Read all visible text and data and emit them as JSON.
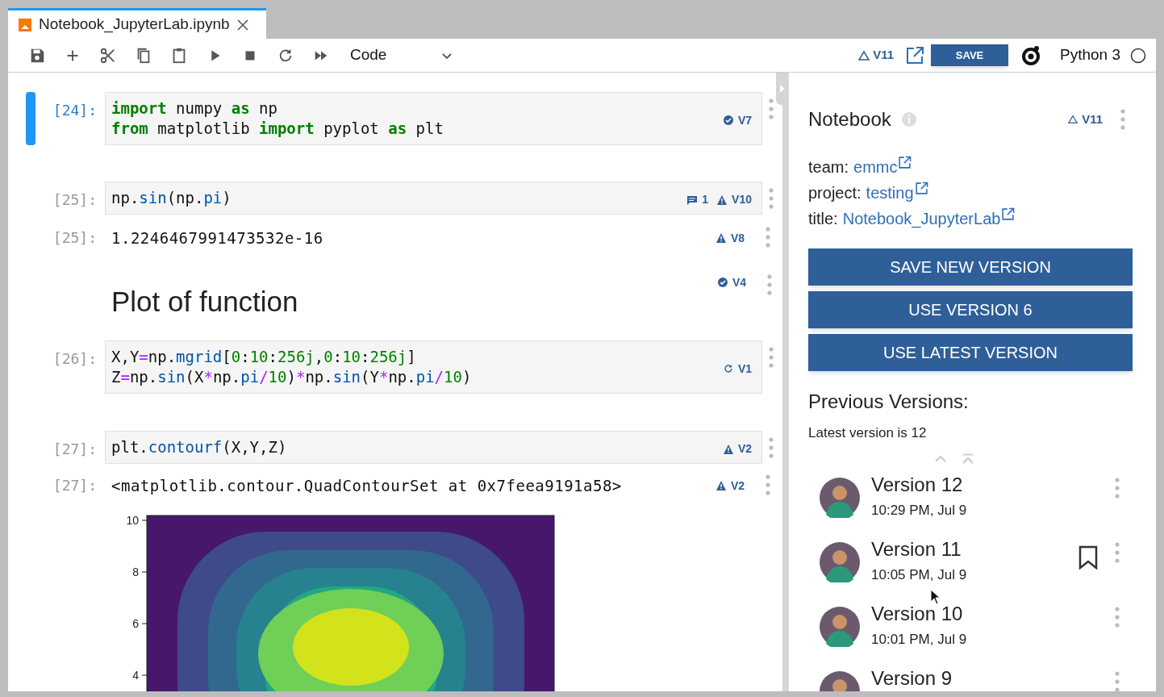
{
  "tab": {
    "title": "Notebook_JupyterLab.ipynb"
  },
  "toolbar": {
    "cell_type": "Code",
    "version": "V11",
    "save": "SAVE",
    "kernel": "Python 3"
  },
  "cells": [
    {
      "kind": "code",
      "prompt": "[24]:",
      "selected": true,
      "lines": [
        [
          {
            "kind": "keyword",
            "text": "import"
          },
          {
            "kind": "plain",
            "text": " numpy "
          },
          {
            "kind": "keyword",
            "text": "as"
          },
          {
            "kind": "plain",
            "text": " np"
          }
        ],
        [
          {
            "kind": "keyword",
            "text": "from"
          },
          {
            "kind": "plain",
            "text": " matplotlib "
          },
          {
            "kind": "keyword",
            "text": "import"
          },
          {
            "kind": "plain",
            "text": " pyplot "
          },
          {
            "kind": "keyword",
            "text": "as"
          },
          {
            "kind": "plain",
            "text": " plt"
          }
        ]
      ],
      "badges": [
        {
          "kind": "check",
          "text": "V7"
        }
      ]
    },
    {
      "kind": "code",
      "prompt": "[25]:",
      "selected": false,
      "lines": [
        [
          {
            "kind": "plain",
            "text": "np."
          },
          {
            "kind": "attr",
            "text": "sin"
          },
          {
            "kind": "plain",
            "text": "(np."
          },
          {
            "kind": "attr",
            "text": "pi"
          },
          {
            "kind": "plain",
            "text": ")"
          }
        ]
      ],
      "badges": [
        {
          "kind": "comment",
          "text": "1"
        },
        {
          "kind": "warn",
          "text": "V10"
        }
      ]
    },
    {
      "kind": "output",
      "prompt": "[25]:",
      "text": "1.2246467991473532e-16",
      "badges": [
        {
          "kind": "warn",
          "text": "V8"
        }
      ]
    },
    {
      "kind": "markdown",
      "text": "Plot of function",
      "badges": [
        {
          "kind": "check",
          "text": "V4"
        }
      ]
    },
    {
      "kind": "code",
      "prompt": "[26]:",
      "selected": false,
      "lines": [
        [
          {
            "kind": "plain",
            "text": "X,Y"
          },
          {
            "kind": "op",
            "text": "="
          },
          {
            "kind": "plain",
            "text": "np."
          },
          {
            "kind": "attr",
            "text": "mgrid"
          },
          {
            "kind": "plain",
            "text": "["
          },
          {
            "kind": "num",
            "text": "0"
          },
          {
            "kind": "plain",
            "text": ":"
          },
          {
            "kind": "num",
            "text": "10"
          },
          {
            "kind": "plain",
            "text": ":"
          },
          {
            "kind": "num",
            "text": "256j"
          },
          {
            "kind": "plain",
            "text": ","
          },
          {
            "kind": "num",
            "text": "0"
          },
          {
            "kind": "plain",
            "text": ":"
          },
          {
            "kind": "num",
            "text": "10"
          },
          {
            "kind": "plain",
            "text": ":"
          },
          {
            "kind": "num",
            "text": "256j"
          },
          {
            "kind": "plain",
            "text": "]"
          }
        ],
        [
          {
            "kind": "plain",
            "text": "Z"
          },
          {
            "kind": "op",
            "text": "="
          },
          {
            "kind": "plain",
            "text": "np."
          },
          {
            "kind": "attr",
            "text": "sin"
          },
          {
            "kind": "plain",
            "text": "(X"
          },
          {
            "kind": "op",
            "text": "*"
          },
          {
            "kind": "plain",
            "text": "np."
          },
          {
            "kind": "attr",
            "text": "pi"
          },
          {
            "kind": "op",
            "text": "/"
          },
          {
            "kind": "num",
            "text": "10"
          },
          {
            "kind": "plain",
            "text": ")"
          },
          {
            "kind": "op",
            "text": "*"
          },
          {
            "kind": "plain",
            "text": "np."
          },
          {
            "kind": "attr",
            "text": "sin"
          },
          {
            "kind": "plain",
            "text": "(Y"
          },
          {
            "kind": "op",
            "text": "*"
          },
          {
            "kind": "plain",
            "text": "np."
          },
          {
            "kind": "attr",
            "text": "pi"
          },
          {
            "kind": "op",
            "text": "/"
          },
          {
            "kind": "num",
            "text": "10"
          },
          {
            "kind": "plain",
            "text": ")"
          }
        ]
      ],
      "badges": [
        {
          "kind": "sync",
          "text": "V1"
        }
      ]
    },
    {
      "kind": "code",
      "prompt": "[27]:",
      "selected": false,
      "lines": [
        [
          {
            "kind": "plain",
            "text": "plt."
          },
          {
            "kind": "attr",
            "text": "contourf"
          },
          {
            "kind": "plain",
            "text": "(X,Y,Z)"
          }
        ]
      ],
      "badges": [
        {
          "kind": "warn",
          "text": "V2"
        }
      ]
    },
    {
      "kind": "output",
      "prompt": "[27]:",
      "text": "<matplotlib.contour.QuadContourSet at 0x7feea9191a58>",
      "badges": [
        {
          "kind": "warn",
          "text": "V2"
        }
      ]
    },
    {
      "kind": "plot",
      "yticks": [
        "10",
        "8",
        "6",
        "4"
      ]
    }
  ],
  "sidebar": {
    "title": "Notebook",
    "version": "V11",
    "meta": [
      {
        "label": "team:",
        "value": "emmc"
      },
      {
        "label": "project:",
        "value": "testing"
      },
      {
        "label": "title:",
        "value": "Notebook_JupyterLab"
      }
    ],
    "buttons": [
      "SAVE NEW VERSION",
      "USE VERSION 6",
      "USE LATEST VERSION"
    ],
    "previous_title": "Previous Versions:",
    "latest_note": "Latest version is 12",
    "versions": [
      {
        "title": "Version 12",
        "time": "10:29 PM, Jul 9",
        "bookmarked": false
      },
      {
        "title": "Version 11",
        "time": "10:05 PM, Jul 9",
        "bookmarked": true
      },
      {
        "title": "Version 10",
        "time": "10:01 PM, Jul 9",
        "bookmarked": false
      },
      {
        "title": "Version 9",
        "bookmarked": false
      }
    ]
  }
}
